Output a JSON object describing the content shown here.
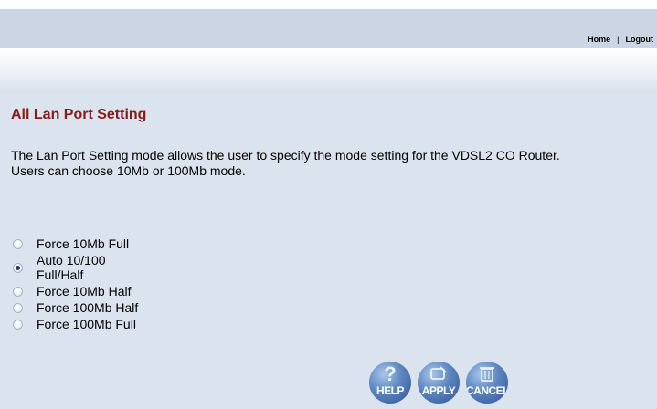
{
  "header": {
    "links": [
      {
        "label": "Home"
      },
      {
        "label": "Logout"
      }
    ],
    "separator": "|"
  },
  "main": {
    "title": "All Lan Port Setting",
    "description_line1": "The Lan Port Setting mode allows the user to specify the mode setting for the VDSL2 CO Router.",
    "description_line2": "Users can choose 10Mb or 100Mb mode."
  },
  "options": [
    {
      "label": "Force 10Mb Full",
      "checked": false
    },
    {
      "label": "Auto 10/100 Full/Half",
      "checked": true
    },
    {
      "label": "Force 10Mb Half",
      "checked": false
    },
    {
      "label": "Force 100Mb Half",
      "checked": false
    },
    {
      "label": "Force 100Mb Full",
      "checked": false
    }
  ],
  "buttons": [
    {
      "label": "HELP",
      "icon": "help-icon"
    },
    {
      "label": "APPLY",
      "icon": "apply-icon"
    },
    {
      "label": "CANCEL",
      "icon": "cancel-icon"
    }
  ],
  "colors": {
    "title": "#8a1b1b",
    "background": "#dbe3ee",
    "button": "#2e5593"
  }
}
